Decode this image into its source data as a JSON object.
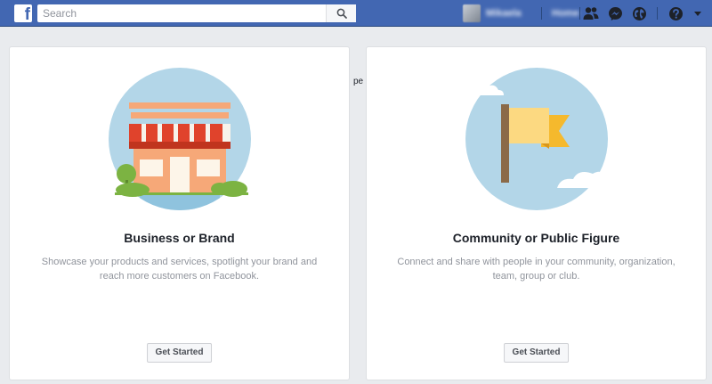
{
  "topbar": {
    "logo_letter": "f",
    "search_placeholder": "Search",
    "profile_name": "Mikaela",
    "home_label": "Home",
    "colors": {
      "bar": "#4267b2",
      "bar_border": "#29487d"
    }
  },
  "stray_text": "pe",
  "cards": [
    {
      "title": "Business or Brand",
      "description": "Showcase your products and services, spotlight your brand and reach more customers on Facebook.",
      "button": "Get Started",
      "illustration": "storefront-illustration"
    },
    {
      "title": "Community or Public Figure",
      "description": "Connect and share with people in your community, organization, team, group or club.",
      "button": "Get Started",
      "illustration": "flag-illustration"
    }
  ]
}
